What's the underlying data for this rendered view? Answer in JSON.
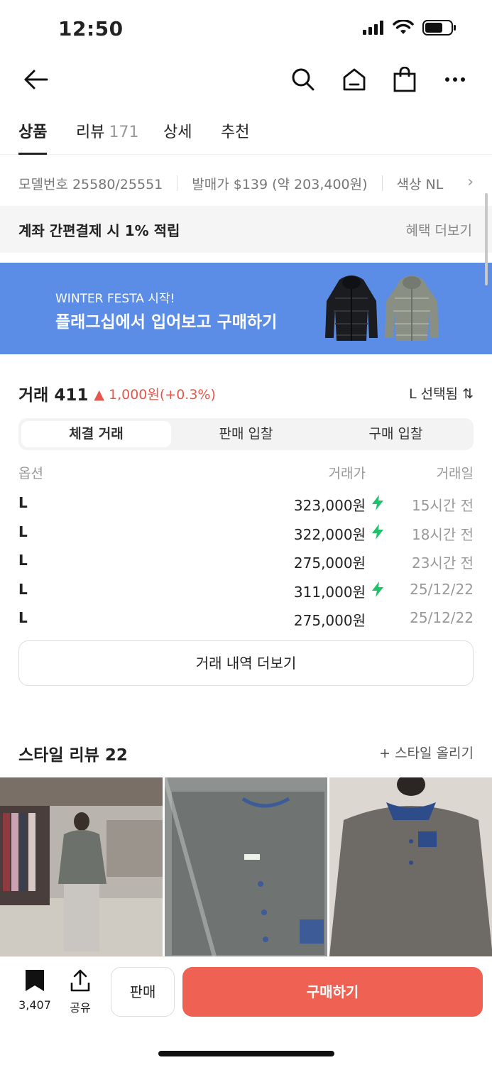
{
  "status_bar": {
    "time": "12:50"
  },
  "tabs": [
    {
      "label": "상품",
      "count": ""
    },
    {
      "label": "리뷰",
      "count": "171"
    },
    {
      "label": "상세",
      "count": ""
    },
    {
      "label": "추천",
      "count": ""
    }
  ],
  "info": {
    "model": "모델번호 25580/25551",
    "release_price": "발매가 $139 (약 203,400원)",
    "color": "색상 NL"
  },
  "benefit": {
    "title": "계좌 간편결제 시 1% 적립",
    "more": "혜택 더보기"
  },
  "banner": {
    "subtitle": "WINTER FESTA 시작!",
    "title": "플래그십에서 입어보고 구매하기"
  },
  "trade": {
    "title": "거래 411",
    "change": "▲ 1,000원(+0.3%)",
    "size_selected": "L 선택됨 ⇅",
    "segments": [
      "체결 거래",
      "판매 입찰",
      "구매 입찰"
    ],
    "columns": {
      "option": "옵션",
      "price": "거래가",
      "date": "거래일"
    },
    "rows": [
      {
        "option": "L",
        "price": "323,000원",
        "quick": true,
        "date": "15시간 전"
      },
      {
        "option": "L",
        "price": "322,000원",
        "quick": true,
        "date": "18시간 전"
      },
      {
        "option": "L",
        "price": "275,000원",
        "quick": false,
        "date": "23시간 전"
      },
      {
        "option": "L",
        "price": "311,000원",
        "quick": true,
        "date": "25/12/22"
      },
      {
        "option": "L",
        "price": "275,000원",
        "quick": false,
        "date": "25/12/22"
      }
    ],
    "more": "거래 내역 더보기"
  },
  "style_review": {
    "title": "스타일 리뷰 22",
    "add": "+ 스타일 올리기"
  },
  "bottom_bar": {
    "save_count": "3,407",
    "share": "공유",
    "sell": "판매",
    "buy": "구매하기"
  },
  "colors": {
    "accent": "#ef6253",
    "banner": "#5b8de6",
    "up": "#e5574a",
    "bolt": "#1fc16b"
  }
}
